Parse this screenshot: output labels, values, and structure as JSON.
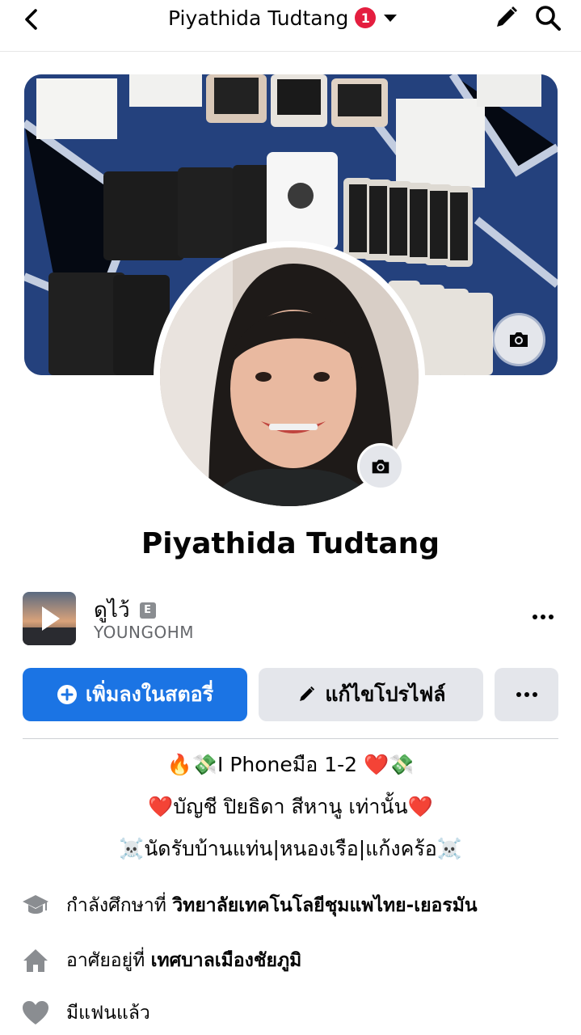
{
  "header": {
    "title": "Piyathida Tudtang",
    "notification_count": "1",
    "back_icon": "chevron-left-icon",
    "edit_icon": "pencil-icon",
    "search_icon": "search-icon"
  },
  "profile": {
    "name": "Piyathida Tudtang"
  },
  "music": {
    "title": "ดูไว้",
    "explicit_badge": "E",
    "artist": "YOUNGOHM"
  },
  "actions": {
    "add_story_label": "เพิ่มลงในสตอรี่",
    "edit_profile_label": "แก้ไขโปรไฟล์"
  },
  "bio": {
    "line1": "🔥💸I Phoneมือ 1-2 ❤️💸",
    "line2": "❤️บัญชี ปิยธิดา สีหานู เท่านั้น❤️",
    "line3": "☠️นัดรับบ้านแท่น|หนองเรือ|แก้งคร้อ☠️"
  },
  "details": [
    {
      "icon": "graduation-cap-icon",
      "prefix": "กำลังศึกษาที่ ",
      "value": "วิทยาลัยเทคโนโลยีชุมแพไทย-เยอรมัน"
    },
    {
      "icon": "home-icon",
      "prefix": "อาศัยอยู่ที่ ",
      "value": "เทศบาลเมืองชัยภูมิ"
    },
    {
      "icon": "heart-icon",
      "prefix": "",
      "value": "มีแฟนแล้ว"
    }
  ],
  "colors": {
    "primary": "#1b74e4",
    "secondary_button": "#e4e6eb",
    "badge": "#e41e3f",
    "muted_text": "#65676b"
  }
}
